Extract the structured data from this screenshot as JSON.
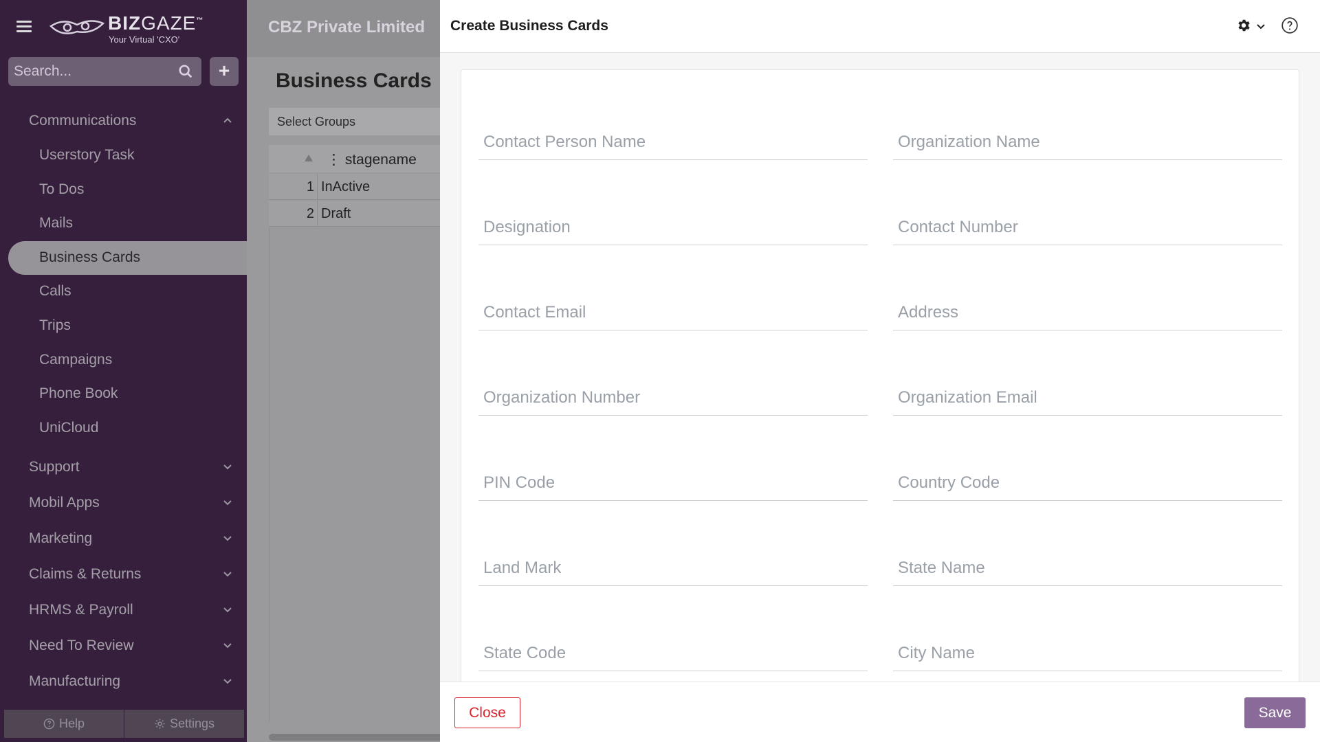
{
  "app": {
    "logo_brand": "BIZ",
    "logo_brand2": "GAZE",
    "logo_tagline": "Your Virtual 'CXO'",
    "company": "CBZ Private Limited"
  },
  "search": {
    "placeholder": "Search..."
  },
  "sidebar": {
    "groups_top": [
      {
        "label": "Communications",
        "expanded": true
      }
    ],
    "communications_items": [
      {
        "label": "Userstory Task",
        "active": false
      },
      {
        "label": "To Dos",
        "active": false
      },
      {
        "label": "Mails",
        "active": false
      },
      {
        "label": "Business Cards",
        "active": true
      },
      {
        "label": "Calls",
        "active": false
      },
      {
        "label": "Trips",
        "active": false
      },
      {
        "label": "Campaigns",
        "active": false
      },
      {
        "label": "Phone Book",
        "active": false
      },
      {
        "label": "UniCloud",
        "active": false
      }
    ],
    "groups_bottom": [
      {
        "label": "Support"
      },
      {
        "label": "Mobil Apps"
      },
      {
        "label": "Marketing"
      },
      {
        "label": "Claims & Returns"
      },
      {
        "label": "HRMS & Payroll"
      },
      {
        "label": "Need To Review"
      },
      {
        "label": "Manufacturing"
      }
    ],
    "footer": {
      "help": "Help",
      "settings": "Settings"
    }
  },
  "main": {
    "title": "Business Cards",
    "select_groups": "Select Groups",
    "grid": {
      "column": "stagename",
      "rows": [
        {
          "num": "1",
          "value": "InActive"
        },
        {
          "num": "2",
          "value": "Draft"
        }
      ]
    }
  },
  "panel": {
    "title": "Create Business Cards",
    "fields": [
      {
        "placeholder": "Contact Person Name",
        "value": ""
      },
      {
        "placeholder": "Organization Name",
        "value": ""
      },
      {
        "placeholder": "Designation",
        "value": ""
      },
      {
        "placeholder": "Contact Number",
        "value": ""
      },
      {
        "placeholder": "Contact Email",
        "value": ""
      },
      {
        "placeholder": "Address",
        "value": ""
      },
      {
        "placeholder": "Organization Number",
        "value": ""
      },
      {
        "placeholder": "Organization Email",
        "value": ""
      },
      {
        "placeholder": "PIN Code",
        "value": ""
      },
      {
        "placeholder": "Country Code",
        "value": ""
      },
      {
        "placeholder": "Land Mark",
        "value": ""
      },
      {
        "placeholder": "State Name",
        "value": ""
      },
      {
        "placeholder": "State Code",
        "value": ""
      },
      {
        "placeholder": "City Name",
        "value": ""
      }
    ],
    "close_label": "Close",
    "save_label": "Save"
  },
  "colors": {
    "sidebar_bg": "#4b2a55",
    "save_button": "#8a6a98",
    "close_button": "#d9232e"
  },
  "icons": {
    "menu": "hamburger-icon",
    "search": "search-icon",
    "add": "plus-icon",
    "settings": "gear-icon",
    "help": "help-circle-icon",
    "expand": "chevron-down-icon",
    "collapse": "chevron-up-icon"
  }
}
